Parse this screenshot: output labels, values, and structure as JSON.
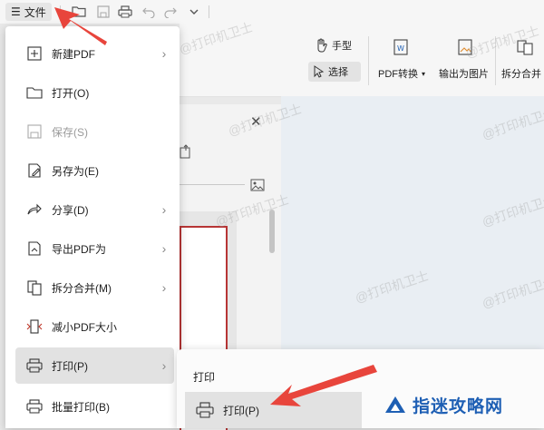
{
  "toolbar": {
    "file_label": "文件",
    "menu_glyph": "☰",
    "icons": [
      "folder-open-icon",
      "save-icon",
      "print-icon",
      "undo-icon",
      "redo-icon",
      "chevron-down-icon"
    ]
  },
  "ribbon": {
    "hand_label": "手型",
    "select_label": "选择",
    "pdf_convert_label": "PDF转换",
    "export_image_label": "输出为图片",
    "split_merge_label": "拆分合并"
  },
  "file_menu": {
    "items": [
      {
        "label": "新建PDF",
        "icon": "new-pdf-icon",
        "submenu": true
      },
      {
        "label": "打开(O)",
        "icon": "folder-icon",
        "submenu": false
      },
      {
        "label": "保存(S)",
        "icon": "save-icon",
        "submenu": false,
        "disabled": true
      },
      {
        "label": "另存为(E)",
        "icon": "save-as-icon",
        "submenu": false
      },
      {
        "label": "分享(D)",
        "icon": "share-icon",
        "submenu": true
      },
      {
        "label": "导出PDF为",
        "icon": "export-pdf-icon",
        "submenu": true
      },
      {
        "label": "拆分合并(M)",
        "icon": "split-merge-icon",
        "submenu": true
      },
      {
        "label": "减小PDF大小",
        "icon": "compress-icon",
        "submenu": false
      },
      {
        "label": "打印(P)",
        "icon": "print-icon",
        "submenu": true,
        "highlighted": true
      },
      {
        "label": "批量打印(B)",
        "icon": "batch-print-icon",
        "submenu": false
      }
    ]
  },
  "print_submenu": {
    "title": "打印",
    "items": [
      {
        "label": "打印(P)",
        "icon": "print-icon"
      }
    ]
  },
  "watermark": "@打印机卫士",
  "logo": {
    "text": "指迷攻略网"
  },
  "colors": {
    "arrow": "#e8453c",
    "highlight": "#e2e2e2",
    "logo_blue": "#1e5fb4"
  }
}
